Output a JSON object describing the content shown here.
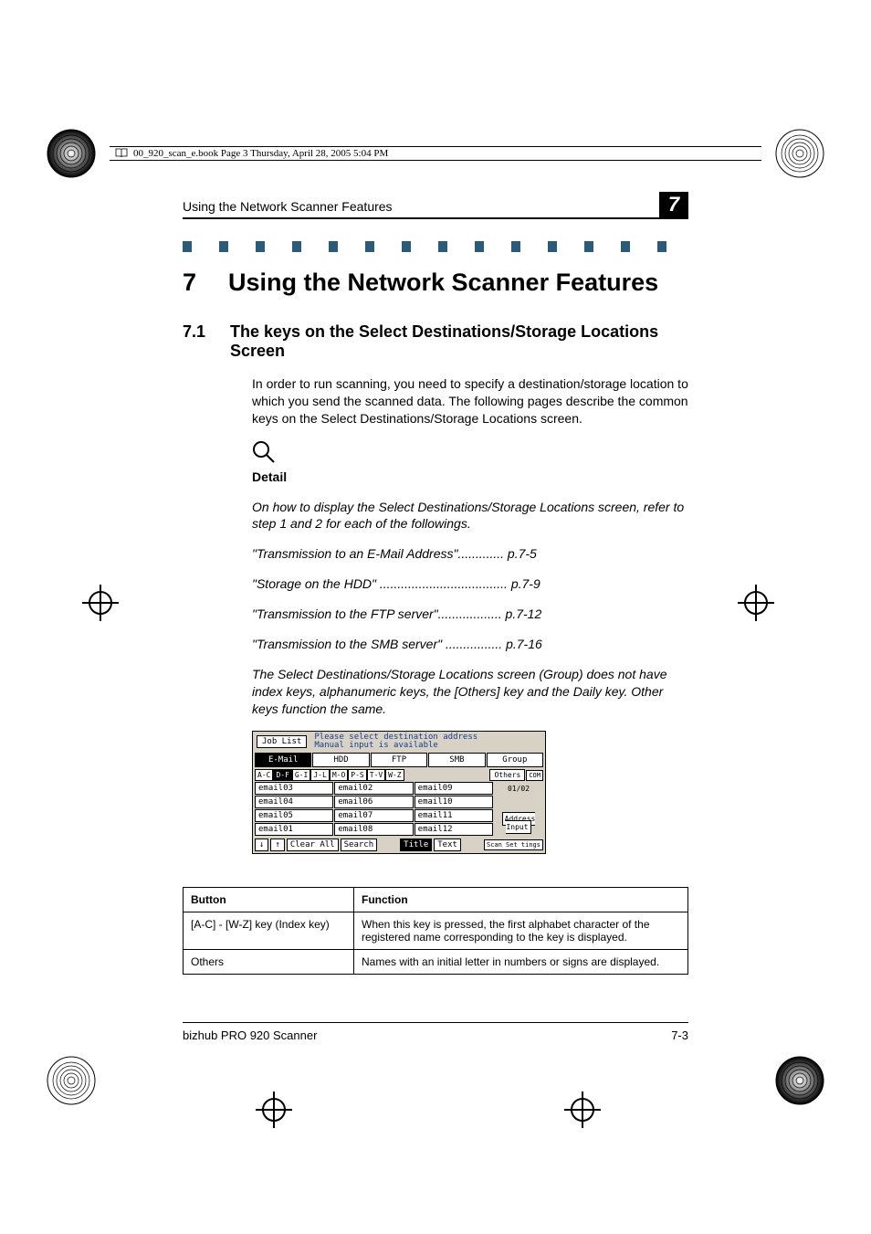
{
  "fileHeader": "00_920_scan_e.book  Page 3  Thursday, April 28, 2005  5:04 PM",
  "runningHead": "Using the Network Scanner Features",
  "chapterTab": "7",
  "chapter": {
    "num": "7",
    "title": "Using the Network Scanner Features"
  },
  "section": {
    "num": "7.1",
    "title": "The keys on the Select Destinations/Storage Locations Screen"
  },
  "intro": "In order to run scanning, you need to specify a destination/storage location to which you send the scanned data. The following pages describe the common keys on the Select Destinations/Storage Locations screen.",
  "detailLabel": "Detail",
  "detailText": "On how to display the Select Destinations/Storage Locations screen, refer to step 1 and 2 for each of the followings.",
  "refs": [
    "\"Transmission to an E-Mail Address\"............. p.7-5",
    "\"Storage on the HDD\" .................................... p.7-9",
    "\"Transmission to the FTP server\".................. p.7-12",
    "\"Transmission to the SMB server\" ................ p.7-16"
  ],
  "note": "The Select Destinations/Storage Locations screen (Group) does not have index keys, alphanumeric keys, the [Others] key and the Daily key. Other keys function the same.",
  "panel": {
    "jobList": "Job List",
    "msg1": "Please select destination address",
    "msg2": "Manual input is available",
    "tabs": [
      "E-Mail",
      "HDD",
      "FTP",
      "SMB",
      "Group"
    ],
    "alpha": [
      "A-C",
      "D-F",
      "G-I",
      "J-L",
      "M-O",
      "P-S",
      "T-V",
      "W-Z"
    ],
    "others": "Others",
    "com": "COM",
    "col1": [
      "email03",
      "email04",
      "email05",
      "email01"
    ],
    "col2": [
      "email02",
      "email06",
      "email07",
      "email08"
    ],
    "col3": [
      "email09",
      "email10",
      "email11",
      "email12"
    ],
    "pageIndicator": "01/02",
    "addrInput": "Address Input",
    "footer": {
      "down": "↓",
      "up": "↑",
      "clear": "Clear All",
      "search": "Search",
      "title": "Title",
      "text": "Text",
      "scanset": "Scan Set tings"
    }
  },
  "table": {
    "headButton": "Button",
    "headFunction": "Function",
    "rows": [
      {
        "b": "[A-C] - [W-Z] key (Index key)",
        "f": "When this key is pressed, the first alphabet character of the registered name corresponding to the key is displayed."
      },
      {
        "b": "Others",
        "f": "Names with an initial letter in numbers or signs are displayed."
      }
    ]
  },
  "footer": {
    "left": "bizhub PRO 920 Scanner",
    "right": "7-3"
  }
}
